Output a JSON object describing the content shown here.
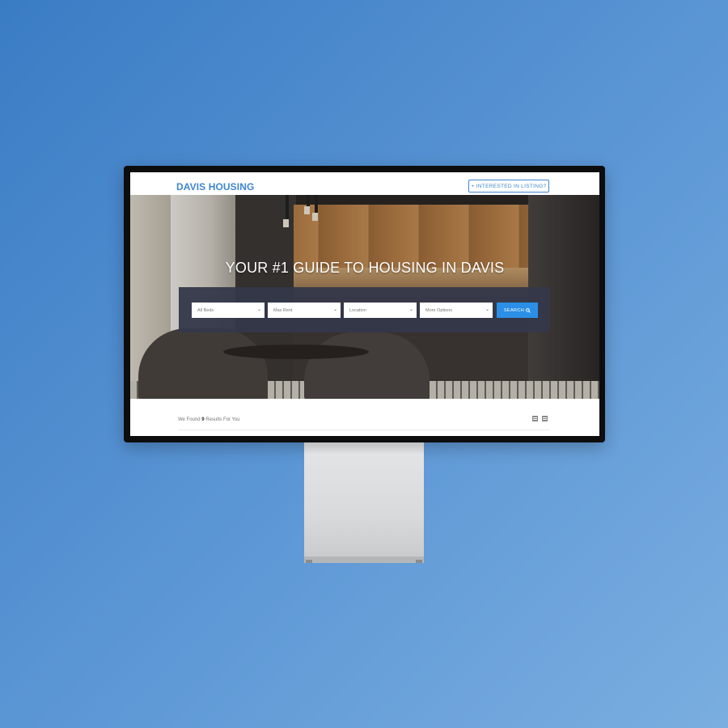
{
  "header": {
    "logo": "DAVIS HOUSING",
    "interested_button": "+ INTERESTED IN LISTING?"
  },
  "hero": {
    "title": "YOUR #1 GUIDE TO HOUSING IN DAVIS"
  },
  "search": {
    "beds": "All Beds",
    "max_rent": "Max Rent",
    "location": "Location",
    "more_options": "More Options",
    "submit": "SEARCH"
  },
  "results": {
    "prefix": "We Found",
    "count": "9",
    "suffix": "Results For You"
  },
  "colors": {
    "brand": "#3f86cf",
    "search_button": "#2b8fe8",
    "panel": "#34384a"
  },
  "icons": {
    "search": "search-icon",
    "chevron": "chevron-down-icon",
    "list_view": "list-view-icon",
    "grid_view": "grid-view-icon"
  }
}
